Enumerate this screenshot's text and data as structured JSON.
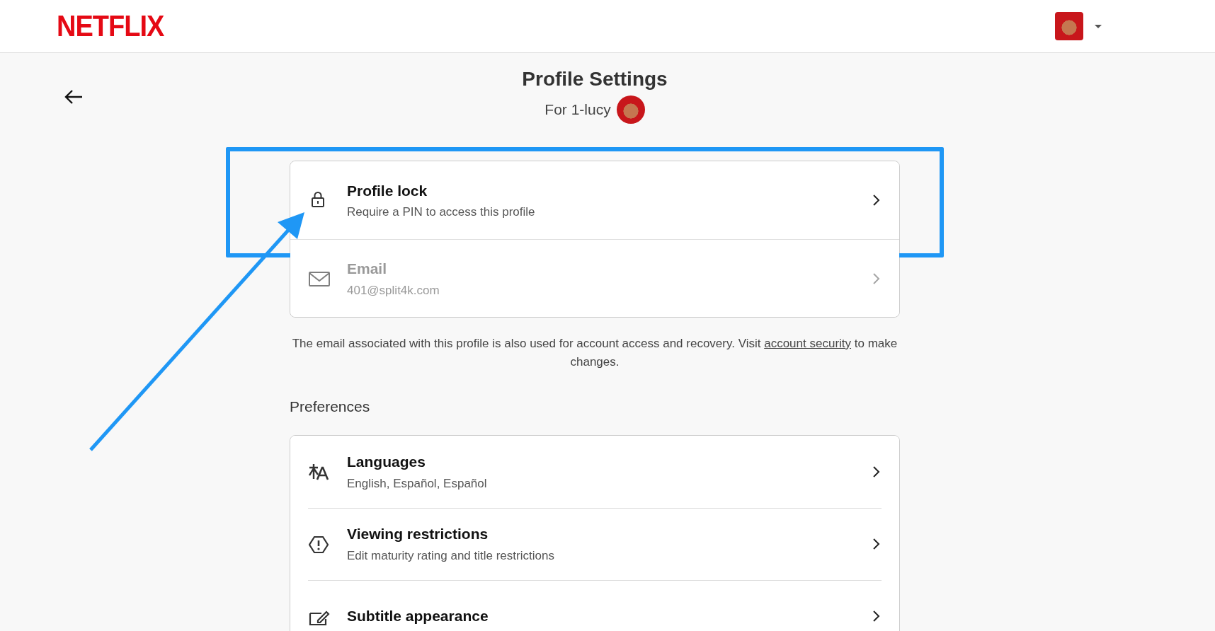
{
  "header": {
    "logo": "NETFLIX"
  },
  "page": {
    "title": "Profile Settings",
    "subtitle": "For 1-lucy"
  },
  "account_items": [
    {
      "kind": "lock",
      "title": "Profile lock",
      "subtitle": "Require a PIN to access this profile",
      "disabled": false,
      "highlighted": true
    },
    {
      "kind": "email",
      "title": "Email",
      "subtitle": "401@split4k.com",
      "disabled": true,
      "highlighted": false
    }
  ],
  "note": {
    "before": "The email associated with this profile is also used for account access and recovery. Visit ",
    "link": "account security",
    "after": " to make changes."
  },
  "preferences": {
    "heading": "Preferences",
    "items": [
      {
        "kind": "languages",
        "title": "Languages",
        "subtitle": "English, Español, Español"
      },
      {
        "kind": "restrictions",
        "title": "Viewing restrictions",
        "subtitle": "Edit maturity rating and title restrictions"
      },
      {
        "kind": "subtitles",
        "title": "Subtitle appearance"
      }
    ]
  }
}
